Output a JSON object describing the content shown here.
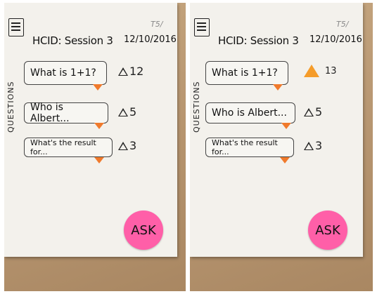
{
  "panels": [
    {
      "title": "HCID: Session 3",
      "date": "12/10/2016",
      "pencil_note": "T5/",
      "section_label": "QUESTIONS",
      "questions": [
        {
          "text": "What is 1+1?",
          "votes": "12"
        },
        {
          "text": "Who is Albert...",
          "votes": "5"
        },
        {
          "text": "What's the result for...",
          "votes": "3"
        }
      ],
      "ask_label": "ASK"
    },
    {
      "title": "HCID: Session 3",
      "date": "12/10/2016",
      "pencil_note": "T5/",
      "section_label": "QUESTIONS",
      "questions": [
        {
          "text": "What is 1+1?",
          "votes": "13"
        },
        {
          "text": "Who is Albert...",
          "votes": "5"
        },
        {
          "text": "What's the result for...",
          "votes": "3"
        }
      ],
      "ask_label": "ASK"
    }
  ],
  "colors": {
    "orange": "#f07a2c",
    "upvote_active": "#f59c2a",
    "ask_pink": "#ff5fa8",
    "paper": "#f3f1ec",
    "table_wood": "#b99873"
  },
  "icons": {
    "menu": "hamburger-menu-icon",
    "upvote": "triangle-upvote-icon"
  }
}
